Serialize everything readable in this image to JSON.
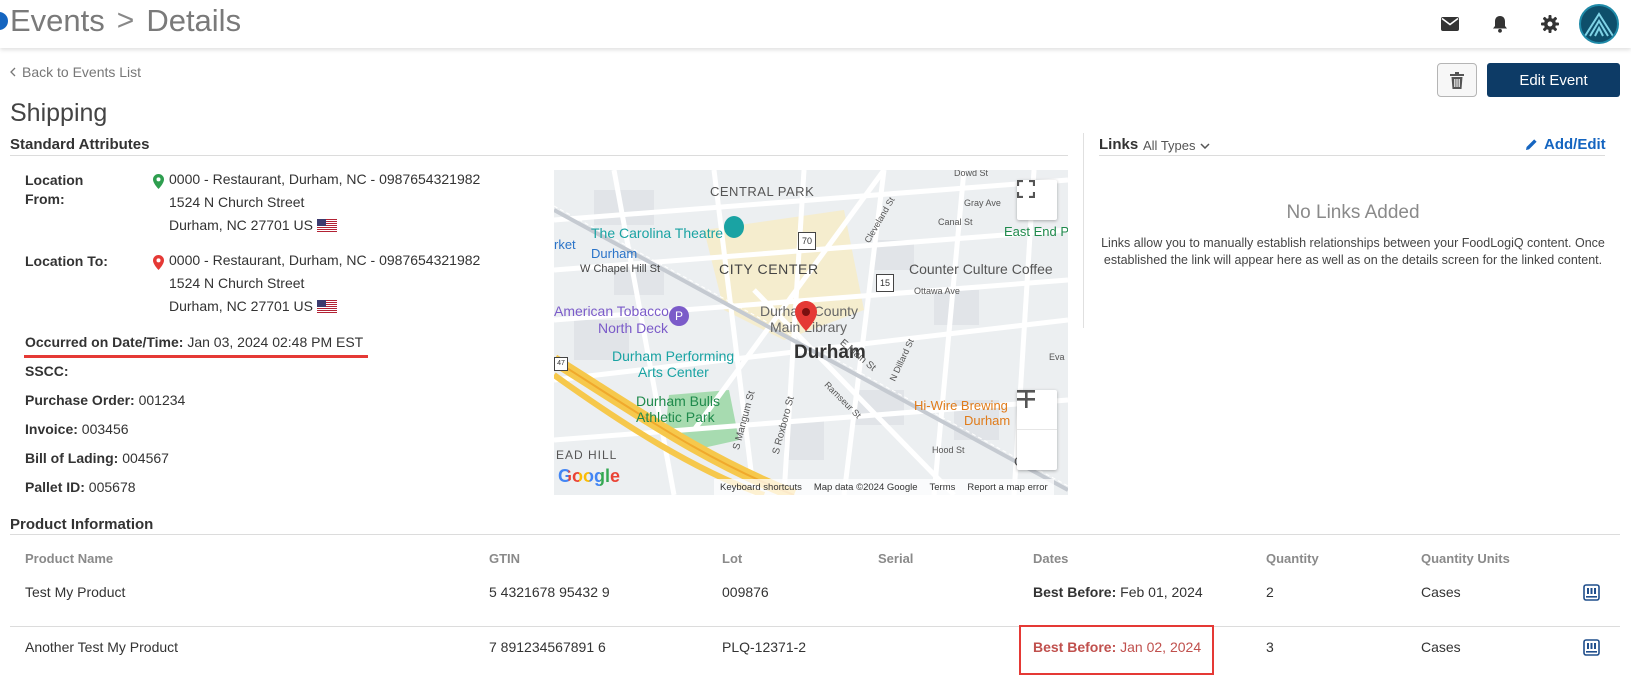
{
  "header": {
    "breadcrumb_root": "Events",
    "breadcrumb_separator": ">",
    "breadcrumb_current": "Details",
    "icons": [
      "mail-icon",
      "bell-icon",
      "gear-icon",
      "avatar-logo"
    ]
  },
  "actions": {
    "back_label": "Back to Events List",
    "edit_label": "Edit Event"
  },
  "page": {
    "title": "Shipping",
    "standard_attributes_title": "Standard Attributes"
  },
  "attributes": {
    "location_from_label": "Location From:",
    "location_from_line1": "0000 - Restaurant, Durham, NC - 0987654321982",
    "location_from_line2": "1524 N Church Street",
    "location_from_line3": "Durham, NC 27701 US",
    "location_to_label": "Location To:",
    "location_to_line1": "0000 - Restaurant, Durham, NC - 0987654321982",
    "location_to_line2": "1524 N Church Street",
    "location_to_line3": "Durham, NC 27701 US",
    "occurred_label": "Occurred on Date/Time:",
    "occurred_value": "Jan 03, 2024 02:48 PM EST",
    "sscc_label": "SSCC:",
    "po_label": "Purchase Order:",
    "po_value": "001234",
    "invoice_label": "Invoice:",
    "invoice_value": "003456",
    "bol_label": "Bill of Lading:",
    "bol_value": "004567",
    "pallet_label": "Pallet ID:",
    "pallet_value": "005678"
  },
  "map": {
    "labels": {
      "central_park": "CENTRAL PARK",
      "carolina_theatre": "The Carolina Theatre",
      "durham_station": "Durham",
      "w_chapel_hill": "W Chapel Hill St",
      "city_center": "CITY CENTER",
      "counter_culture": "Counter Culture Coffee",
      "american_tobacco_1": "American Tobacco",
      "american_tobacco_2": "North Deck",
      "county_library_1": "Durham County",
      "county_library_2": "Main Library",
      "durham_big": "Durham",
      "dpac_1": "Durham Performing",
      "dpac_2": "Arts Center",
      "bulls_1": "Durham Bulls",
      "bulls_2": "Athletic Park",
      "hiwire_1": "Hi-Wire Brewing",
      "hiwire_2": "Durham",
      "east_end": "East End P",
      "ead_hill": "EAD HILL",
      "rket": "rket",
      "google": "Google",
      "ottawa": "Ottawa Ave",
      "gray_ave": "Gray Ave",
      "canal_st": "Canal St",
      "dowd_st": "Dowd St",
      "e_main": "E Main St",
      "s_mangum": "S Mangum St",
      "s_roxboro": "S Roxboro St",
      "ramseur": "Ramseur St",
      "n_dillard": "N Dillard St",
      "hood_st": "Hood St",
      "cleveland": "Cleveland St",
      "eva": "Eva",
      "go": "GO",
      "shield_70": "70",
      "shield_15": "15",
      "shield_147": "47",
      "shield_bus": "BUS"
    },
    "footer": {
      "shortcuts": "Keyboard shortcuts",
      "map_data": "Map data ©2024 Google",
      "terms": "Terms",
      "report": "Report a map error"
    }
  },
  "links": {
    "title": "Links",
    "filter": "All Types",
    "add_edit": "Add/Edit",
    "empty_title": "No Links Added",
    "empty_desc": "Links allow you to manually establish relationships between your FoodLogiQ content. Once established the link will appear here as well as on the details screen for the linked content."
  },
  "products": {
    "section_title": "Product Information",
    "columns": [
      "Product Name",
      "GTIN",
      "Lot",
      "Serial",
      "Dates",
      "Quantity",
      "Quantity Units"
    ],
    "rows": [
      {
        "name": "Test My Product",
        "gtin": "5 4321678 95432 9",
        "lot": "009876",
        "serial": "",
        "date_label": "Best Before:",
        "date_value": "Feb 01, 2024",
        "quantity": "2",
        "units": "Cases"
      },
      {
        "name": "Another Test My Product",
        "gtin": "7 891234567891 6",
        "lot": "PLQ-12371-2",
        "serial": "",
        "date_label": "Best Before:",
        "date_value": "Jan 02, 2024",
        "quantity": "3",
        "units": "Cases"
      }
    ]
  },
  "colors": {
    "primary_button": "#0d3b66",
    "link_blue": "#1565c0",
    "alert_red": "#e53935",
    "expired_text": "#c0504d"
  }
}
